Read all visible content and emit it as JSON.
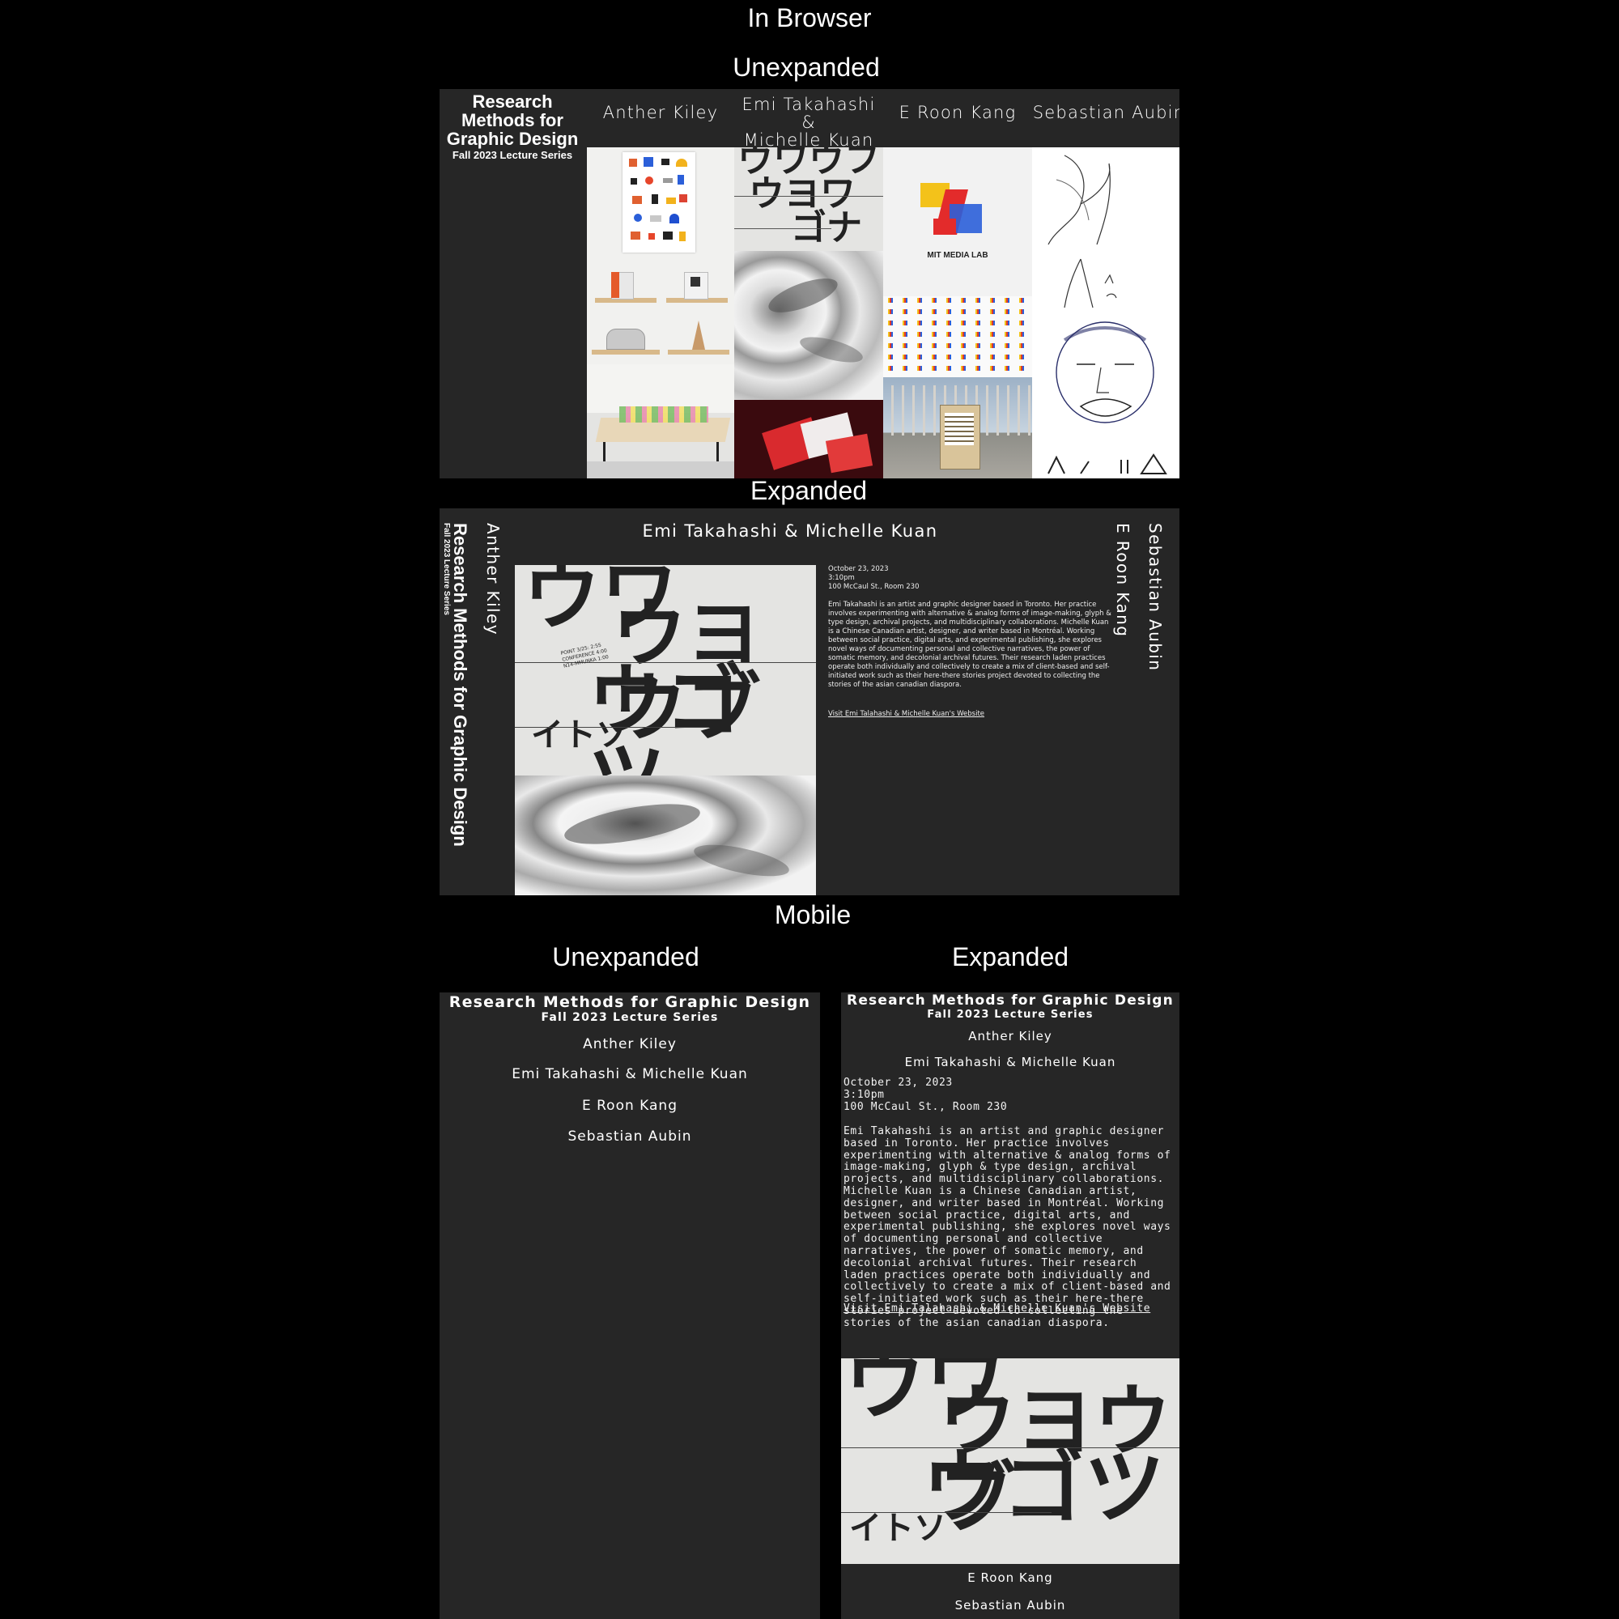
{
  "sections": {
    "browser": "In Browser",
    "unexpanded": "Unexpanded",
    "expanded": "Expanded",
    "mobile": "Mobile",
    "mobile_unexpanded": "Unexpanded",
    "mobile_expanded": "Expanded"
  },
  "site": {
    "title_l1": "Research",
    "title_l2": "Methods for",
    "title_l3": "Graphic Design",
    "title_full": "Research Methods for Graphic Design",
    "subtitle": "Fall 2023 Lecture Series"
  },
  "speakers": {
    "s1": "Anther Kiley",
    "s2": "Emi Takahashi & Michelle Kuan",
    "s2_l1": "Emi Takahashi &",
    "s2_l2": "Michelle Kuan",
    "s3": "E Roon Kang",
    "s4": "Sebastian Aubin"
  },
  "event": {
    "date": "October 23, 2023",
    "time": "3:10pm",
    "location": "100 McCaul St., Room 230",
    "bio": "Emi Takahashi is an artist and graphic designer based in Toronto. Her practice involves experimenting with alternative & analog forms of image-making, glyph & type design, archival projects, and multidisciplinary collaborations. Michelle Kuan is a Chinese Canadian artist, designer, and writer based in Montréal. Working between social practice, digital arts, and experimental publishing, she explores novel ways of documenting personal and collective narratives, the power of somatic memory, and decolonial archival futures. Their research laden practices operate both individually and collectively to create a mix of client-based and self-initiated work such as their here-there stories project devoted to collecting the stories of the asian canadian diaspora.",
    "link": "Visit Emi Talahashi & Michelle Kuan's Website"
  },
  "images": {
    "mit_logo_text": "MIT MEDIA LAB",
    "poster_small_text": "POINT 3/25: 2:55\nCONFERENCE 4:00\nN14-MMUNKA 1:00"
  },
  "colors": {
    "page_bg": "#000000",
    "panel_bg": "#262626",
    "text": "#ffffff"
  }
}
